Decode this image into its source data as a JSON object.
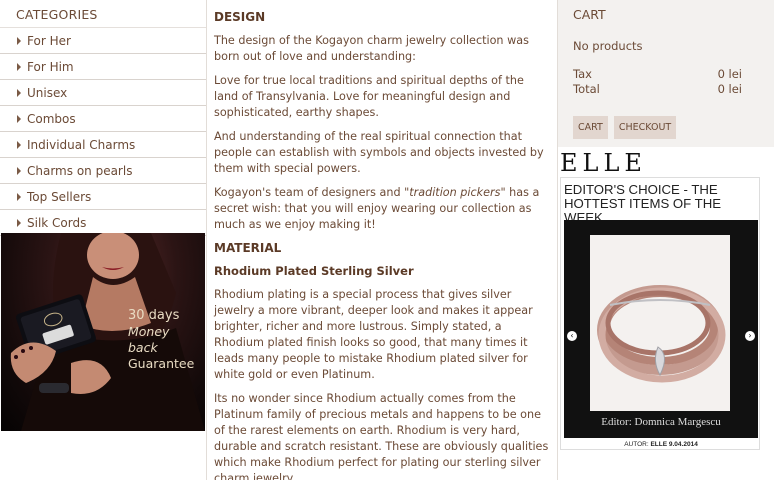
{
  "categories": {
    "title": "CATEGORIES",
    "items": [
      {
        "label": "For Her"
      },
      {
        "label": "For Him"
      },
      {
        "label": "Unisex"
      },
      {
        "label": "Combos"
      },
      {
        "label": "Individual Charms"
      },
      {
        "label": "Charms on pearls"
      },
      {
        "label": "Top Sellers"
      },
      {
        "label": "Silk Cords"
      }
    ]
  },
  "promo": {
    "line1": "30 days",
    "line2": "Money back",
    "line3": "Guarantee"
  },
  "content": {
    "design_heading": "DESIGN",
    "p1": "The design of the Kogayon charm jewelry collection was born out of love and understanding:",
    "p2": "Love for true local traditions and spiritual depths of the land of Transylvania. Love for meaningful design and sophisticated, earthy shapes.",
    "p3": "And understanding of the real spiritual connection that people can establish with symbols and objects invested by them with special powers.",
    "p4_before": "Kogayon's team of designers and ",
    "p4_em": "\"tradition pickers\"",
    "p4_after": " has a secret wish: that you will enjoy wearing our collection as much as we enjoy making it!",
    "material_heading": "MATERIAL",
    "material_subheading": "Rhodium Plated Sterling Silver",
    "p5": "Rhodium plating is a special process that gives silver jewelry a more vibrant, deeper look and makes it appear brighter, richer and more lustrous. Simply stated, a Rhodium plated finish looks so good, that many times it leads many people to mistake Rhodium plated silver for white gold or even Platinum.",
    "p6": "Its no wonder since Rhodium actually comes from the Platinum family of precious metals and happens to be one of the rarest elements on earth. Rhodium is very hard, durable and scratch resistant. These are obviously qualities which make Rhodium perfect for plating our sterling silver charm jewelry."
  },
  "cart": {
    "title": "CART",
    "empty_text": "No products",
    "tax_label": "Tax",
    "tax_value": "0 lei",
    "total_label": "Total",
    "total_value": "0 lei",
    "cart_button": "CART",
    "checkout_button": "CHECKOUT"
  },
  "elle": {
    "logo": "ELLE",
    "headline": "EDITOR'S CHOICE - THE HOTTEST ITEMS OF THE WEEK.",
    "caption": "Editor: Domnica Margescu",
    "author_prefix": "AUTOR:",
    "author_name": "ELLE",
    "author_date": "9.04.2014",
    "prev_arrow": "‹",
    "next_arrow": "›"
  },
  "colors": {
    "text": "#6b4a36",
    "cart_bg": "#f3f1ef",
    "button_bg": "#e2d6cf"
  }
}
